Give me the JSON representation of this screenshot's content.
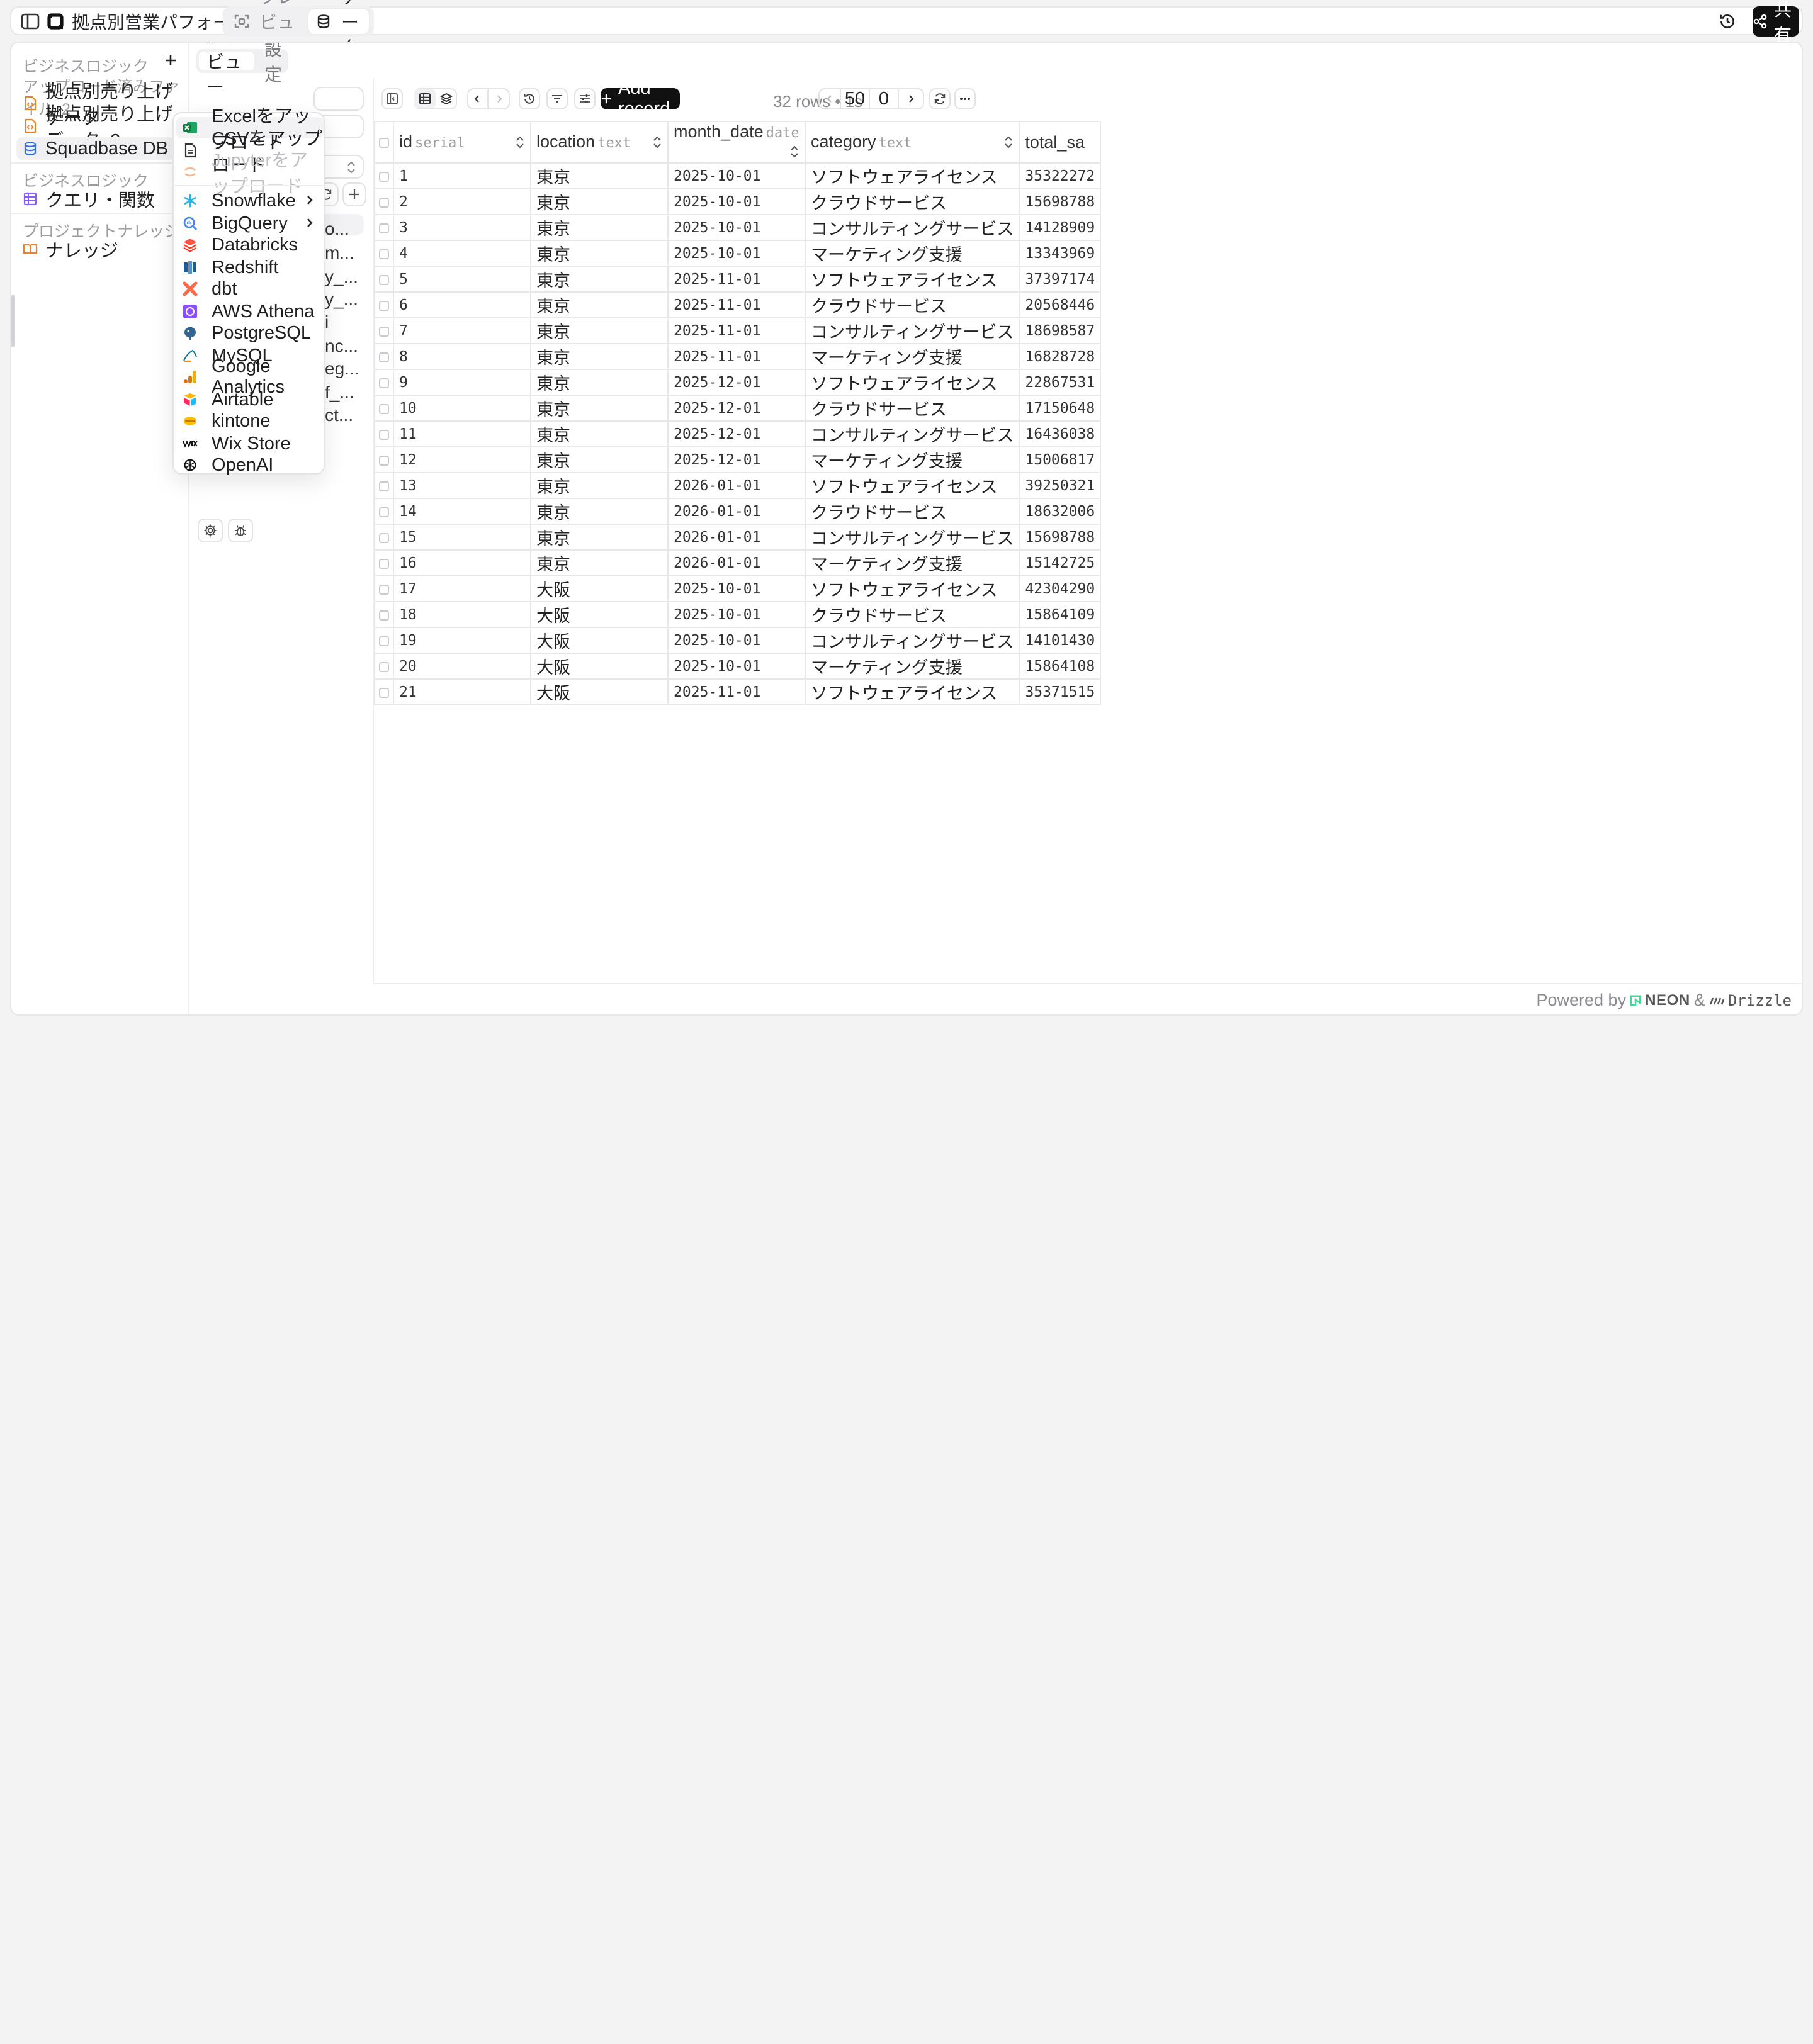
{
  "topbar": {
    "project_title": "拠点別営業パフォーマンス分析",
    "tabs": [
      {
        "label": "プレビュー",
        "active": false
      },
      {
        "label": "データ",
        "active": true
      }
    ],
    "share_label": "共有"
  },
  "sidebar": {
    "section1_title": "ビジネスロジック",
    "uploaded_label": "アップロード済みファイル",
    "uploaded_count": "2",
    "items": [
      {
        "label": "拠点別売り上げデータ",
        "icon": "file-code-icon"
      },
      {
        "label": "拠点別売り上げデータ_2",
        "icon": "file-code-icon"
      },
      {
        "label": "Squadbase DB",
        "icon": "database-icon"
      }
    ],
    "section2_title": "ビジネスロジック",
    "query_label": "クエリ・関数",
    "section3_title": "プロジェクトナレッジ",
    "knowledge_label": "ナレッジ"
  },
  "middle": {
    "tabs": [
      {
        "label": "プレビュー",
        "active": true
      },
      {
        "label": "設定",
        "active": false
      }
    ],
    "list_fragments": [
      "o...",
      "m...",
      "y_...",
      "y_...",
      "i",
      "nc...",
      "eg...",
      "f_...",
      "ct..."
    ]
  },
  "menu": {
    "items": [
      {
        "label": "Excelをアップロード",
        "icon": "excel-icon",
        "highlighted": true,
        "disabled": false,
        "submenu": false
      },
      {
        "label": "CSVをアップロード",
        "icon": "csv-file-icon",
        "highlighted": false,
        "disabled": false,
        "submenu": false
      },
      {
        "label": "Jupyterをアップロード",
        "icon": "jupyter-icon",
        "highlighted": false,
        "disabled": true,
        "submenu": false
      },
      {
        "label": "Snowflake",
        "icon": "snowflake-icon",
        "highlighted": false,
        "disabled": false,
        "submenu": true
      },
      {
        "label": "BigQuery",
        "icon": "bigquery-icon",
        "highlighted": false,
        "disabled": false,
        "submenu": true
      },
      {
        "label": "Databricks",
        "icon": "databricks-icon",
        "highlighted": false,
        "disabled": false,
        "submenu": false
      },
      {
        "label": "Redshift",
        "icon": "redshift-icon",
        "highlighted": false,
        "disabled": false,
        "submenu": false
      },
      {
        "label": "dbt",
        "icon": "dbt-icon",
        "highlighted": false,
        "disabled": false,
        "submenu": false
      },
      {
        "label": "AWS Athena",
        "icon": "aws-athena-icon",
        "highlighted": false,
        "disabled": false,
        "submenu": false
      },
      {
        "label": "PostgreSQL",
        "icon": "postgresql-icon",
        "highlighted": false,
        "disabled": false,
        "submenu": false
      },
      {
        "label": "MySQL",
        "icon": "mysql-icon",
        "highlighted": false,
        "disabled": false,
        "submenu": false
      },
      {
        "label": "Google Analytics",
        "icon": "google-analytics-icon",
        "highlighted": false,
        "disabled": false,
        "submenu": false
      },
      {
        "label": "Airtable",
        "icon": "airtable-icon",
        "highlighted": false,
        "disabled": false,
        "submenu": false
      },
      {
        "label": "kintone",
        "icon": "kintone-icon",
        "highlighted": false,
        "disabled": false,
        "submenu": false
      },
      {
        "label": "Wix Store",
        "icon": "wix-icon",
        "highlighted": false,
        "disabled": false,
        "submenu": false
      },
      {
        "label": "OpenAI",
        "icon": "openai-icon",
        "highlighted": false,
        "disabled": false,
        "submenu": false
      }
    ]
  },
  "toolbar": {
    "add_record_label": "Add record",
    "rows_info": "32 rows • 1s",
    "limit": "50",
    "offset": "0"
  },
  "table": {
    "columns": [
      {
        "name": "id",
        "type": "serial"
      },
      {
        "name": "location",
        "type": "text"
      },
      {
        "name": "month_date",
        "type": "date"
      },
      {
        "name": "category",
        "type": "text"
      },
      {
        "name": "total_sa",
        "type": ""
      }
    ],
    "rows": [
      [
        "1",
        "東京",
        "2025-10-01",
        "ソフトウェアライセンス",
        "35322272"
      ],
      [
        "2",
        "東京",
        "2025-10-01",
        "クラウドサービス",
        "15698788"
      ],
      [
        "3",
        "東京",
        "2025-10-01",
        "コンサルティングサービス",
        "14128909"
      ],
      [
        "4",
        "東京",
        "2025-10-01",
        "マーケティング支援",
        "13343969"
      ],
      [
        "5",
        "東京",
        "2025-11-01",
        "ソフトウェアライセンス",
        "37397174"
      ],
      [
        "6",
        "東京",
        "2025-11-01",
        "クラウドサービス",
        "20568446"
      ],
      [
        "7",
        "東京",
        "2025-11-01",
        "コンサルティングサービス",
        "18698587"
      ],
      [
        "8",
        "東京",
        "2025-11-01",
        "マーケティング支援",
        "16828728"
      ],
      [
        "9",
        "東京",
        "2025-12-01",
        "ソフトウェアライセンス",
        "22867531"
      ],
      [
        "10",
        "東京",
        "2025-12-01",
        "クラウドサービス",
        "17150648"
      ],
      [
        "11",
        "東京",
        "2025-12-01",
        "コンサルティングサービス",
        "16436038"
      ],
      [
        "12",
        "東京",
        "2025-12-01",
        "マーケティング支援",
        "15006817"
      ],
      [
        "13",
        "東京",
        "2026-01-01",
        "ソフトウェアライセンス",
        "39250321"
      ],
      [
        "14",
        "東京",
        "2026-01-01",
        "クラウドサービス",
        "18632006"
      ],
      [
        "15",
        "東京",
        "2026-01-01",
        "コンサルティングサービス",
        "15698788"
      ],
      [
        "16",
        "東京",
        "2026-01-01",
        "マーケティング支援",
        "15142725"
      ],
      [
        "17",
        "大阪",
        "2025-10-01",
        "ソフトウェアライセンス",
        "42304290"
      ],
      [
        "18",
        "大阪",
        "2025-10-01",
        "クラウドサービス",
        "15864109"
      ],
      [
        "19",
        "大阪",
        "2025-10-01",
        "コンサルティングサービス",
        "14101430"
      ],
      [
        "20",
        "大阪",
        "2025-10-01",
        "マーケティング支援",
        "15864108"
      ],
      [
        "21",
        "大阪",
        "2025-11-01",
        "ソフトウェアライセンス",
        "35371515"
      ]
    ]
  },
  "footer": {
    "powered_by": "Powered by",
    "neon": "NEON",
    "amp": "&",
    "drizzle": "Drizzle"
  },
  "colors": {
    "accent_dark": "#111111",
    "excel": "#1d7a43",
    "snowflake": "#29b5e8",
    "dbt": "#ff694a"
  }
}
